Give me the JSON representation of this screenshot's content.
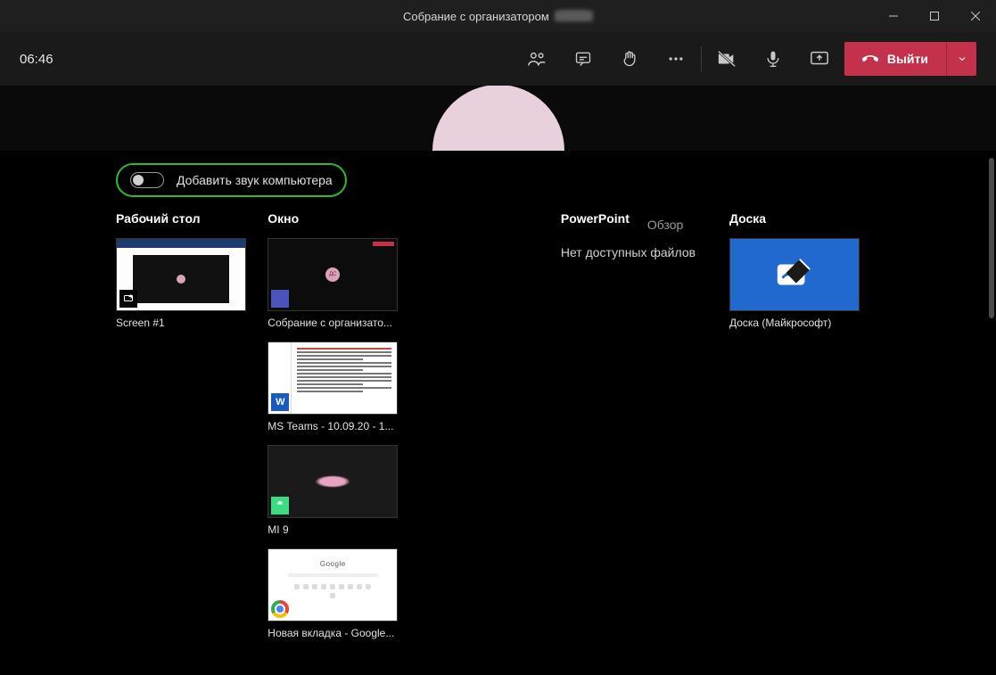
{
  "titlebar": {
    "prefix": "Собрание с организатором",
    "blurred": "████"
  },
  "toolbar": {
    "timer": "06:46",
    "leave_label": "Выйти"
  },
  "share": {
    "audio_toggle_label": "Добавить звук компьютера",
    "desktop_header": "Рабочий стол",
    "window_header": "Окно",
    "powerpoint_header": "PowerPoint",
    "overview_link": "Обзор",
    "board_header": "Доска",
    "powerpoint_msg": "Нет доступных файлов",
    "chrome_logo": "Google"
  },
  "thumbs": {
    "screen1": "Screen #1",
    "win1": "Собрание с организато...",
    "win2": "MS Teams - 10.09.20 - 1...",
    "win3": "MI 9",
    "win4": "Новая вкладка - Google...",
    "board": "Доска (Майкрософт)",
    "avatar_sm": "ДС"
  }
}
